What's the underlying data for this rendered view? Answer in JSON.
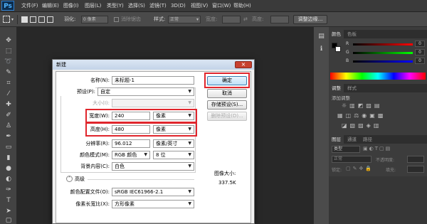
{
  "app": {
    "logo": "Ps"
  },
  "menubar": {
    "items": [
      "文件(F)",
      "编辑(E)",
      "图像(I)",
      "图层(L)",
      "类型(Y)",
      "选择(S)",
      "滤镜(T)",
      "3D(D)",
      "视图(V)",
      "窗口(W)",
      "帮助(H)"
    ]
  },
  "options_bar": {
    "feather_label": "羽化:",
    "feather_value": "0 像素",
    "antialias_label": "消除锯齿",
    "style_label": "样式:",
    "style_value": "正常",
    "width_label": "宽度:",
    "height_label": "高度:",
    "refine_button": "调整边缘..."
  },
  "right_panels": {
    "color_tabs": [
      "颜色",
      "色板"
    ],
    "color_channels": [
      {
        "label": "R",
        "value": "0"
      },
      {
        "label": "G",
        "value": "0"
      },
      {
        "label": "B",
        "value": "0"
      }
    ],
    "adjust_tabs": [
      "调整",
      "样式"
    ],
    "adjust_hint": "添加调整",
    "layers_tabs": [
      "图层",
      "通道",
      "路径"
    ],
    "layers_kind": "类型",
    "layers_mode": "正常",
    "layers_opacity_label": "不透明度:",
    "layers_lock_label": "锁定:",
    "layers_fill_label": "填充:"
  },
  "dialog": {
    "title": "新建",
    "close": "×",
    "fields": {
      "name_label": "名称(N):",
      "name_value": "未标题-1",
      "preset_label": "预设(P):",
      "preset_value": "自定",
      "size_label": "大小(I):",
      "width_label": "宽度(W):",
      "width_value": "240",
      "width_unit": "像素",
      "height_label": "高度(H):",
      "height_value": "480",
      "height_unit": "像素",
      "resolution_label": "分辨率(R):",
      "resolution_value": "96.012",
      "resolution_unit": "像素/英寸",
      "color_mode_label": "颜色模式(M):",
      "color_mode_value": "RGB 颜色",
      "bit_depth_value": "8 位",
      "background_label": "背景内容(C):",
      "background_value": "白色",
      "advanced_label": "高级",
      "profile_label": "颜色配置文件(O):",
      "profile_value": "sRGB IEC61966-2.1",
      "pixel_aspect_label": "像素长宽比(X):",
      "pixel_aspect_value": "方形像素"
    },
    "buttons": {
      "ok": "确定",
      "cancel": "取消",
      "save_preset": "存储预设(S)...",
      "delete_preset": "删除预设(D)..."
    },
    "image_size_label": "图像大小:",
    "image_size_value": "337.5K"
  },
  "colors": {
    "highlight": "#e0262c",
    "foreground_swatch": "#000000",
    "background_swatch": "#ffffff"
  }
}
